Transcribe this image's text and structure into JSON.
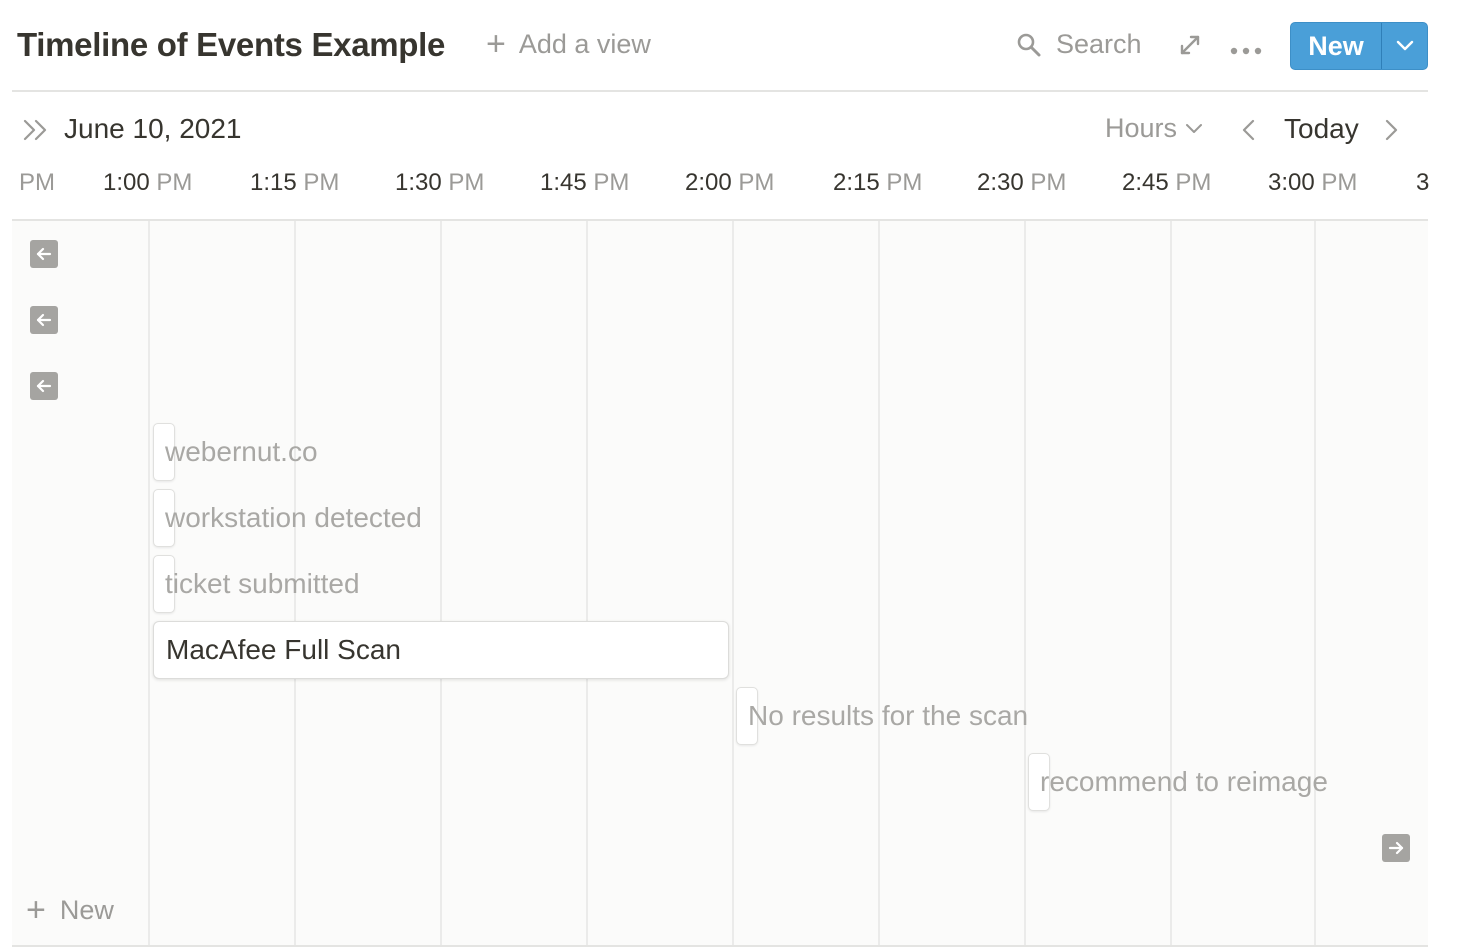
{
  "header": {
    "title": "Timeline of Events Example",
    "add_view_label": "Add a view",
    "search_label": "Search",
    "new_label": "New"
  },
  "subheader": {
    "date": "June 10, 2021",
    "zoom": "Hours",
    "today_label": "Today"
  },
  "axis": {
    "labels": [
      {
        "time": "",
        "ampm": "PM"
      },
      {
        "time": "1:00 ",
        "ampm": "PM"
      },
      {
        "time": "1:15 ",
        "ampm": "PM"
      },
      {
        "time": "1:30 ",
        "ampm": "PM"
      },
      {
        "time": "1:45 ",
        "ampm": "PM"
      },
      {
        "time": "2:00 ",
        "ampm": "PM"
      },
      {
        "time": "2:15 ",
        "ampm": "PM"
      },
      {
        "time": "2:30 ",
        "ampm": "PM"
      },
      {
        "time": "2:45 ",
        "ampm": "PM"
      },
      {
        "time": "3:00 ",
        "ampm": "PM"
      },
      {
        "time": "3",
        "ampm": ""
      }
    ]
  },
  "events": [
    {
      "label": "webernut.co",
      "start": "1:00 PM",
      "end": "1:00 PM"
    },
    {
      "label": "workstation detected",
      "start": "1:00 PM",
      "end": "1:00 PM"
    },
    {
      "label": "ticket submitted",
      "start": "1:00 PM",
      "end": "1:00 PM"
    },
    {
      "label": "MacAfee Full Scan",
      "start": "1:00 PM",
      "end": "2:00 PM"
    },
    {
      "label": "No results for the scan",
      "start": "2:00 PM",
      "end": "2:00 PM"
    },
    {
      "label": "recommend to reimage",
      "start": "2:30 PM",
      "end": "2:30 PM"
    }
  ],
  "footer": {
    "new_label": "New"
  }
}
